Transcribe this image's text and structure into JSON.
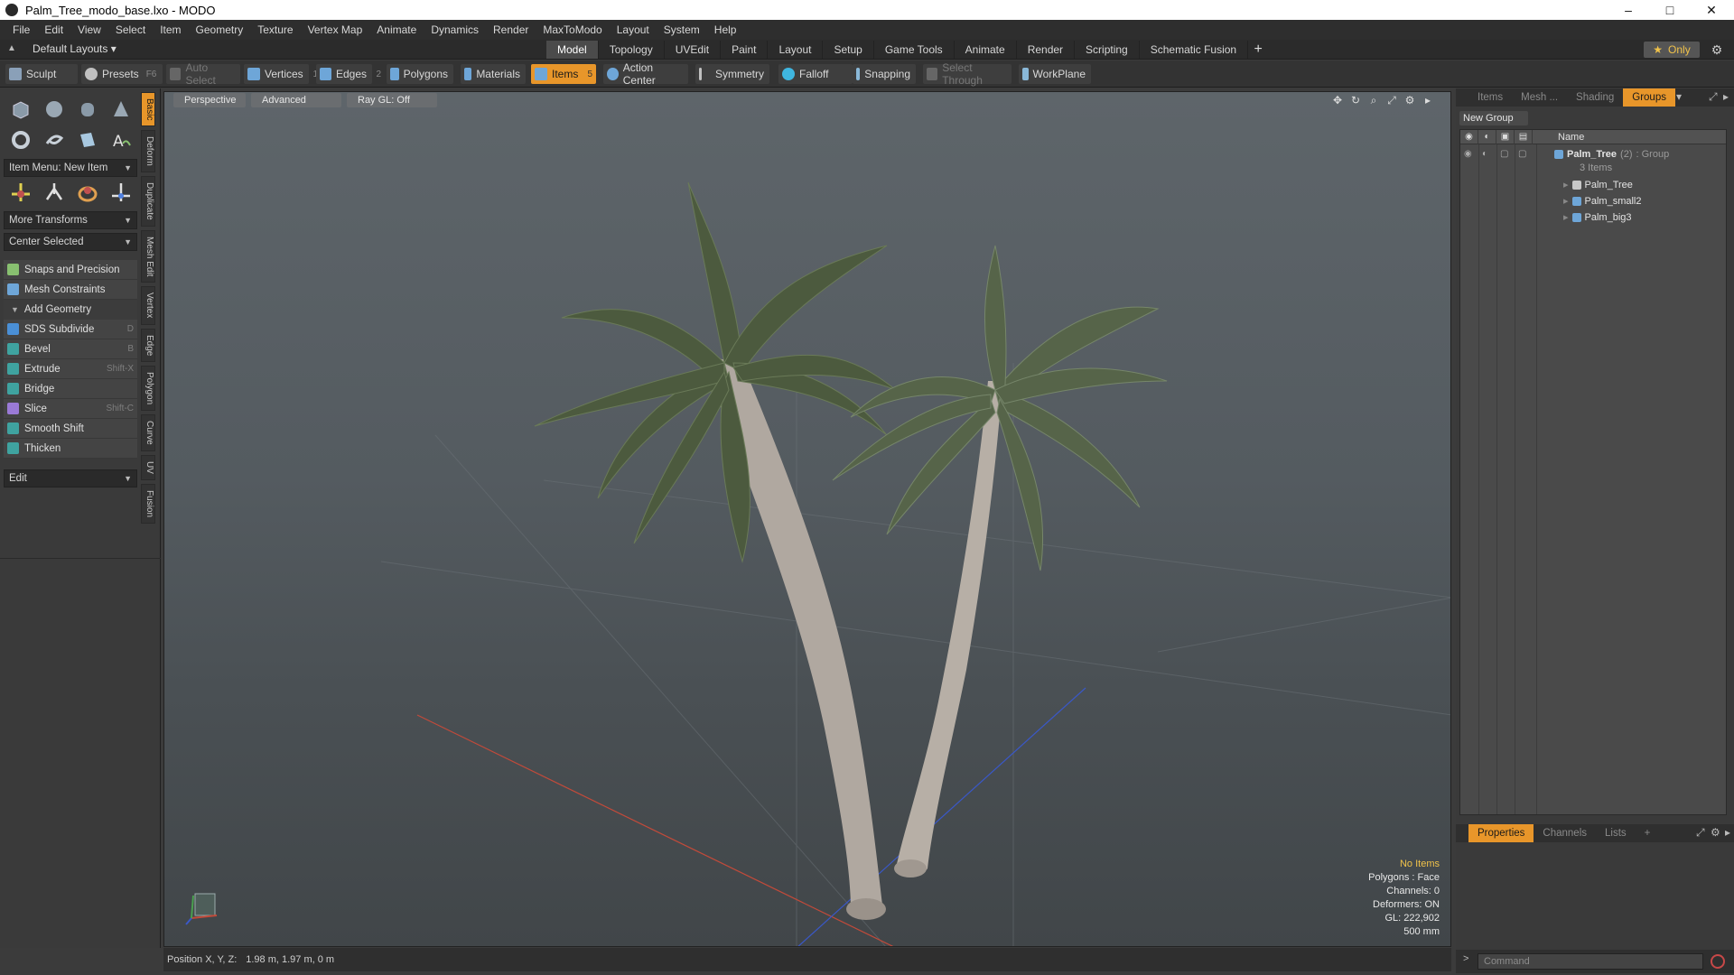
{
  "window": {
    "title": "Palm_Tree_modo_base.lxo - MODO",
    "controls": [
      "–",
      "□",
      "✕"
    ]
  },
  "menu": [
    "File",
    "Edit",
    "View",
    "Select",
    "Item",
    "Geometry",
    "Texture",
    "Vertex Map",
    "Animate",
    "Dynamics",
    "Render",
    "MaxToModo",
    "Layout",
    "System",
    "Help"
  ],
  "layouts": {
    "label": "Default Layouts ▾"
  },
  "tabs": [
    "Model",
    "Topology",
    "UVEdit",
    "Paint",
    "Layout",
    "Setup",
    "Game Tools",
    "Animate",
    "Render",
    "Scripting",
    "Schematic Fusion"
  ],
  "tab_add": "+",
  "only": "Only",
  "toolbar": {
    "sculpt": "Sculpt",
    "presets": "Presets",
    "presets_hint": "F6",
    "auto_select": "Auto Select",
    "vertices": "Vertices",
    "vertices_num": "1",
    "edges": "Edges",
    "edges_num": "2",
    "polygons": "Polygons",
    "materials": "Materials",
    "items": "Items",
    "items_num": "5",
    "action_center": "Action Center",
    "symmetry": "Symmetry",
    "falloff": "Falloff",
    "snapping": "Snapping",
    "select_through": "Select Through",
    "workplane": "WorkPlane"
  },
  "left_panel": {
    "item_menu": "Item Menu: New Item",
    "more_transforms": "More Transforms",
    "center_selected": "Center Selected",
    "snaps": "Snaps and Precision",
    "mesh_constraints": "Mesh Constraints",
    "add_geometry": "Add Geometry",
    "tools": [
      {
        "label": "SDS Subdivide",
        "shortcut": "D",
        "color": "#4a8fd6"
      },
      {
        "label": "Bevel",
        "shortcut": "B",
        "color": "#3fa3a0"
      },
      {
        "label": "Extrude",
        "shortcut": "Shift-X",
        "color": "#3fa3a0"
      },
      {
        "label": "Bridge",
        "shortcut": "",
        "color": "#3fa3a0"
      },
      {
        "label": "Slice",
        "shortcut": "Shift-C",
        "color": "#9a7ad6"
      },
      {
        "label": "Smooth Shift",
        "shortcut": "",
        "color": "#3fa3a0"
      },
      {
        "label": "Thicken",
        "shortcut": "",
        "color": "#3fa3a0"
      }
    ],
    "edit": "Edit",
    "vtabs": [
      "Basic",
      "Deform",
      "Duplicate",
      "Mesh Edit",
      "Vertex",
      "Edge",
      "Polygon",
      "Curve",
      "UV",
      "Fusion"
    ]
  },
  "viewport": {
    "perspective": "Perspective",
    "advanced": "Advanced",
    "raygl": "Ray GL: Off",
    "info": {
      "no_items": "No Items",
      "polygons": "Polygons : Face",
      "channels": "Channels: 0",
      "deformers": "Deformers: ON",
      "gl": "GL: 222,902",
      "size": "500 mm"
    }
  },
  "status": {
    "label": "Position X, Y, Z:",
    "value": "1.98 m, 1.97 m, 0 m"
  },
  "right_panel": {
    "top_tabs": [
      "Items",
      "Mesh ...",
      "Shading",
      "Groups"
    ],
    "new_group": "New Group",
    "name_col": "Name",
    "tree": {
      "group_name": "Palm_Tree",
      "group_count": "(2)",
      "group_type": ": Group",
      "group_items": "3 Items",
      "children": [
        "Palm_Tree",
        "Palm_small2",
        "Palm_big3"
      ]
    },
    "bottom_tabs": [
      "Properties",
      "Channels",
      "Lists"
    ],
    "bottom_add": "+",
    "command_placeholder": "Command",
    "prompt": ">"
  },
  "colors": {
    "accent": "#e8962a",
    "axis_x": "#d04a3a",
    "axis_z": "#3a5ad0"
  }
}
